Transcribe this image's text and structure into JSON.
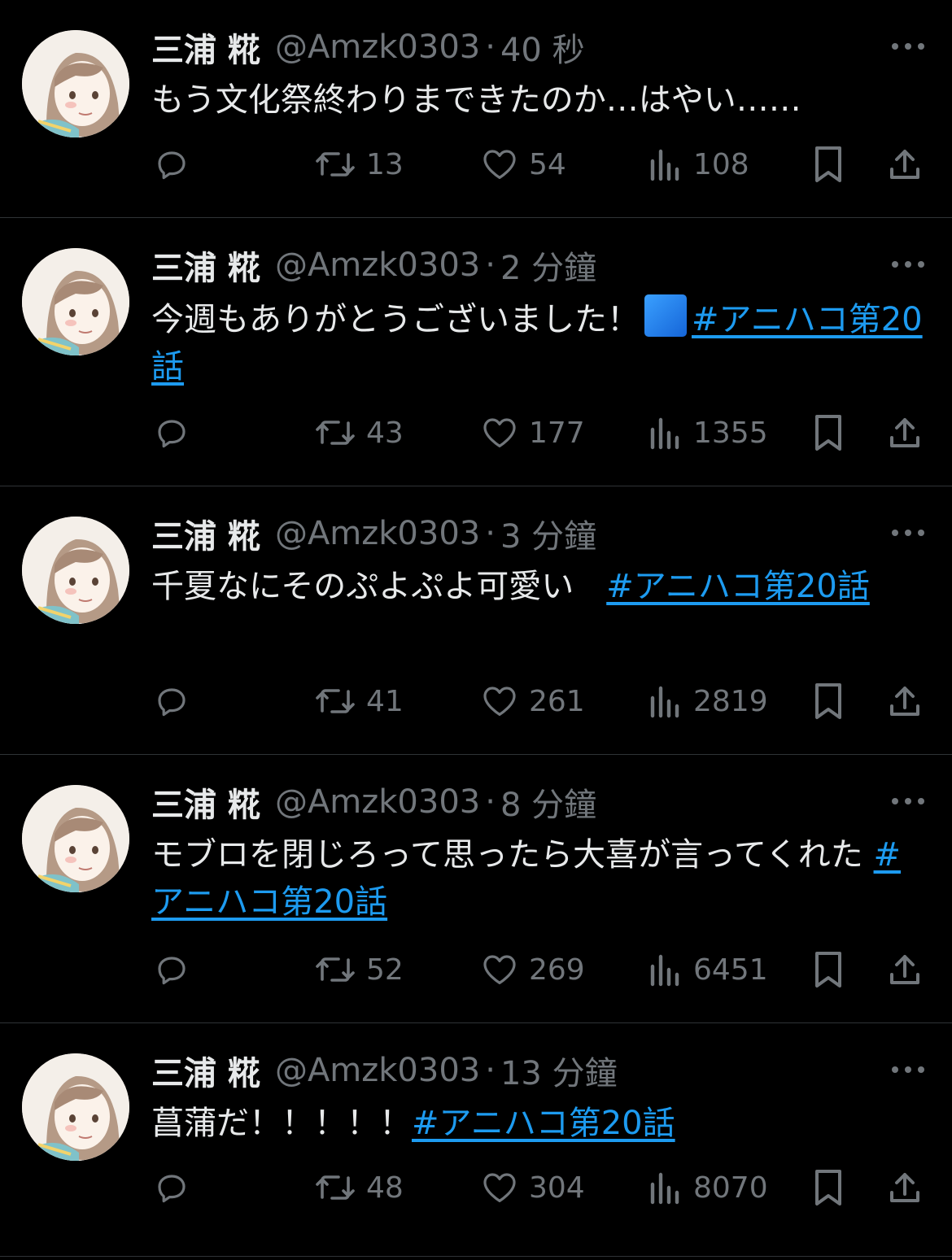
{
  "colors": {
    "background": "#000000",
    "text": "#e7e9ea",
    "muted": "#71767b",
    "link": "#1d9bf0",
    "divider": "#2f3336"
  },
  "tweets": [
    {
      "name": "三浦 糀",
      "handle": "@Amzk0303",
      "separator": "·",
      "time": "40 秒",
      "text_before": "もう文化祭終わりまできたのか…はやい……",
      "emoji": "",
      "hashtag": "",
      "reply_count": "",
      "retweet_count": "13",
      "like_count": "54",
      "view_count": "108"
    },
    {
      "name": "三浦 糀",
      "handle": "@Amzk0303",
      "separator": "·",
      "time": "2 分鐘",
      "text_before": "今週もありがとうございました！",
      "emoji": "blue-square",
      "hashtag": "#アニハコ第20話",
      "reply_count": "",
      "retweet_count": "43",
      "like_count": "177",
      "view_count": "1355"
    },
    {
      "name": "三浦 糀",
      "handle": "@Amzk0303",
      "separator": "·",
      "time": "3 分鐘",
      "text_before": "千夏なにそのぷよぷよ可愛い　",
      "emoji": "",
      "hashtag": "#アニハコ第20話",
      "reply_count": "",
      "retweet_count": "41",
      "like_count": "261",
      "view_count": "2819"
    },
    {
      "name": "三浦 糀",
      "handle": "@Amzk0303",
      "separator": "·",
      "time": "8 分鐘",
      "text_before": "モブロを閉じろって思ったら大喜が言ってくれた",
      "emoji": "",
      "hashtag": "#アニハコ第20話",
      "reply_count": "",
      "retweet_count": "52",
      "like_count": "269",
      "view_count": "6451"
    },
    {
      "name": "三浦 糀",
      "handle": "@Amzk0303",
      "separator": "·",
      "time": "13 分鐘",
      "text_before": "菖蒲だ！！！！！",
      "emoji": "",
      "hashtag": "#アニハコ第20話",
      "reply_count": "",
      "retweet_count": "48",
      "like_count": "304",
      "view_count": "8070"
    }
  ]
}
